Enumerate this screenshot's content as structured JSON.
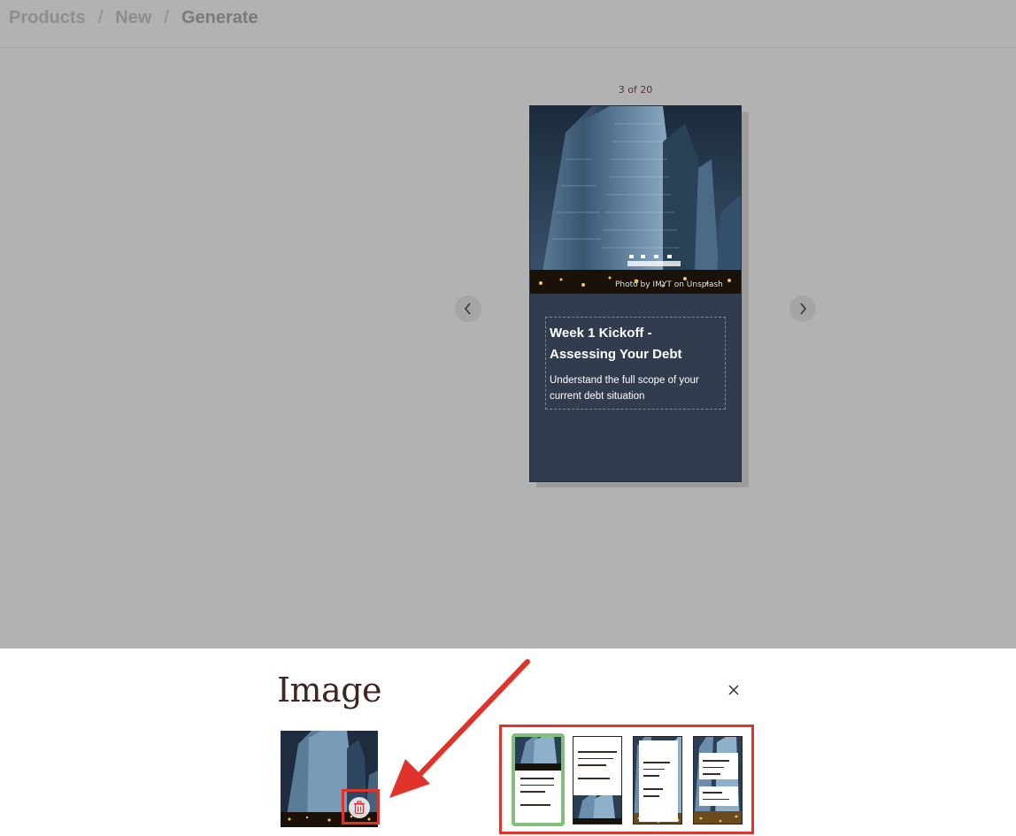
{
  "breadcrumb": {
    "items": [
      "Products",
      "New",
      "Generate"
    ],
    "separator": "/"
  },
  "slider": {
    "counter": "3 of 20"
  },
  "slide": {
    "title": "Week 1 Kickoff - Assessing Your Debt",
    "subtitle": "Understand the full scope of your current debt situation",
    "photo_credit": "Photo by IMYT on Unsplash"
  },
  "panel": {
    "title": "Image",
    "close_symbol": "×"
  },
  "icons": {
    "prev": "chevron-left-icon",
    "next": "chevron-right-icon",
    "close": "close-icon",
    "delete": "trash-icon"
  },
  "layouts": {
    "selected_index": 0,
    "options": [
      "image-top-text-bottom",
      "text-top-image-bottom",
      "text-center-overlay",
      "two-text-boxes-overlay"
    ]
  },
  "colors": {
    "backdrop": "#b2b2b2",
    "card_bg": "#313d4f",
    "highlight": "#e0342a",
    "selected_layout": "#7fc17a",
    "title_text": "#3e2621"
  }
}
